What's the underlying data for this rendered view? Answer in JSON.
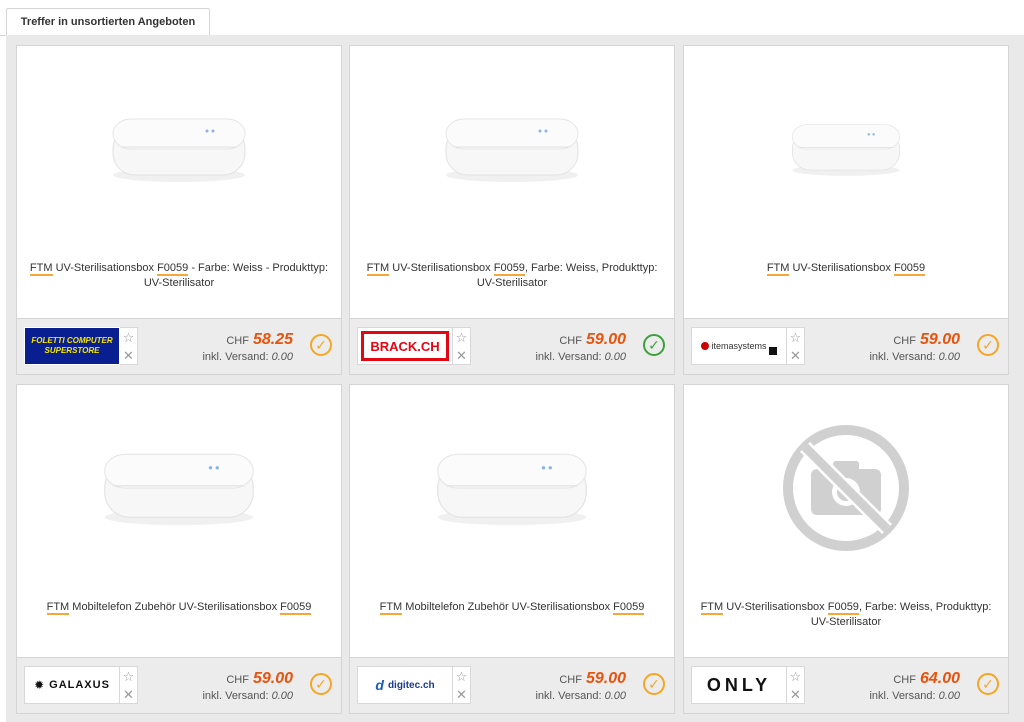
{
  "tab_label": "Treffer in unsortierten Angeboten",
  "currency": "CHF",
  "shipping_label": "inkl. Versand:",
  "offers": [
    {
      "title_brand": "FTM",
      "title_mid": " UV-Sterilisationsbox ",
      "title_code": "F0059",
      "title_rest": " - Farbe: Weiss - Produkttyp: UV-Sterilisator",
      "shop": "FOLETTI COMPUTER SUPERSTORE",
      "shop_line1": "FOLETTI COMPUTER",
      "shop_line2": "SUPERSTORE",
      "price": "58.25",
      "shipping": "0.00",
      "status": "accepted"
    },
    {
      "title_brand": "FTM",
      "title_mid": " UV-Sterilisationsbox ",
      "title_code": "F0059",
      "title_rest": ", Farbe: Weiss, Produkttyp: UV-Sterilisator",
      "shop": "BRACK.CH",
      "price": "59.00",
      "shipping": "0.00",
      "status": "verified"
    },
    {
      "title_brand": "FTM",
      "title_mid": " UV-Sterilisationsbox ",
      "title_code": "F0059",
      "title_rest": "",
      "shop": "itemasystems",
      "price": "59.00",
      "shipping": "0.00",
      "status": "accepted"
    },
    {
      "title_brand": "FTM",
      "title_mid": " Mobiltelefon Zubehör UV-Sterilisationsbox ",
      "title_code": "F0059",
      "title_rest": "",
      "shop": "GALAXUS",
      "price": "59.00",
      "shipping": "0.00",
      "status": "accepted"
    },
    {
      "title_brand": "FTM",
      "title_mid": " Mobiltelefon Zubehör UV-Sterilisationsbox ",
      "title_code": "F0059",
      "title_rest": "",
      "shop": "digitec.ch",
      "price": "59.00",
      "shipping": "0.00",
      "status": "accepted"
    },
    {
      "title_brand": "FTM",
      "title_mid": " UV-Sterilisationsbox ",
      "title_code": "F0059",
      "title_rest": ", Farbe: Weiss, Produkttyp: UV-Sterilisator",
      "shop": "ONLY",
      "price": "64.00",
      "shipping": "0.00",
      "status": "accepted",
      "no_image": true
    }
  ],
  "icons": {
    "favorite": "star-outline-icon",
    "hide": "close-icon",
    "accepted": "check-circle-orange-icon",
    "verified": "check-circle-green-icon",
    "placeholder": "no-photo-icon"
  },
  "colors": {
    "price": "#e8530e",
    "highlight": "#f7a63a",
    "check_orange": "#f5a623",
    "check_green": "#3aa23a",
    "brack_red": "#e30613",
    "foletti_blue": "#0a1f8f",
    "foletti_yellow": "#f7e600"
  }
}
